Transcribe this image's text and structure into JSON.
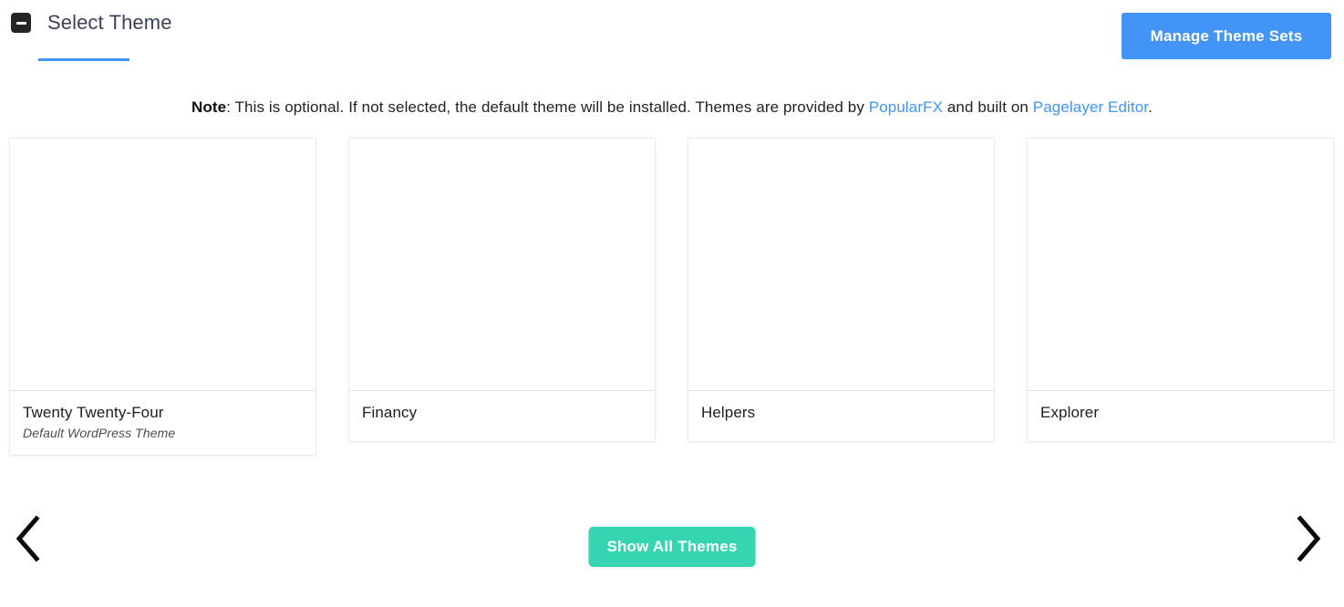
{
  "header": {
    "title": "Select Theme",
    "collapse_icon": "minus-square-icon",
    "manage_button_label": "Manage Theme Sets",
    "accent_color": "#4294f7"
  },
  "note": {
    "bold_prefix": "Note",
    "text_part_1": ": This is optional. If not selected, the default theme will be installed. Themes are provided by ",
    "link_1": "PopularFX",
    "text_part_2": " and built on ",
    "link_2": "Pagelayer Editor",
    "text_part_3": ".",
    "link_color": "#4294f7"
  },
  "themes": [
    {
      "name": "Twenty Twenty-Four",
      "subtitle": "Default WordPress Theme"
    },
    {
      "name": "Financy",
      "subtitle": ""
    },
    {
      "name": "Helpers",
      "subtitle": ""
    },
    {
      "name": "Explorer",
      "subtitle": ""
    }
  ],
  "controls": {
    "prev_arrow": "chevron-left-icon",
    "next_arrow": "chevron-right-icon",
    "show_all_label": "Show All Themes",
    "show_all_color": "#34d5b0"
  }
}
